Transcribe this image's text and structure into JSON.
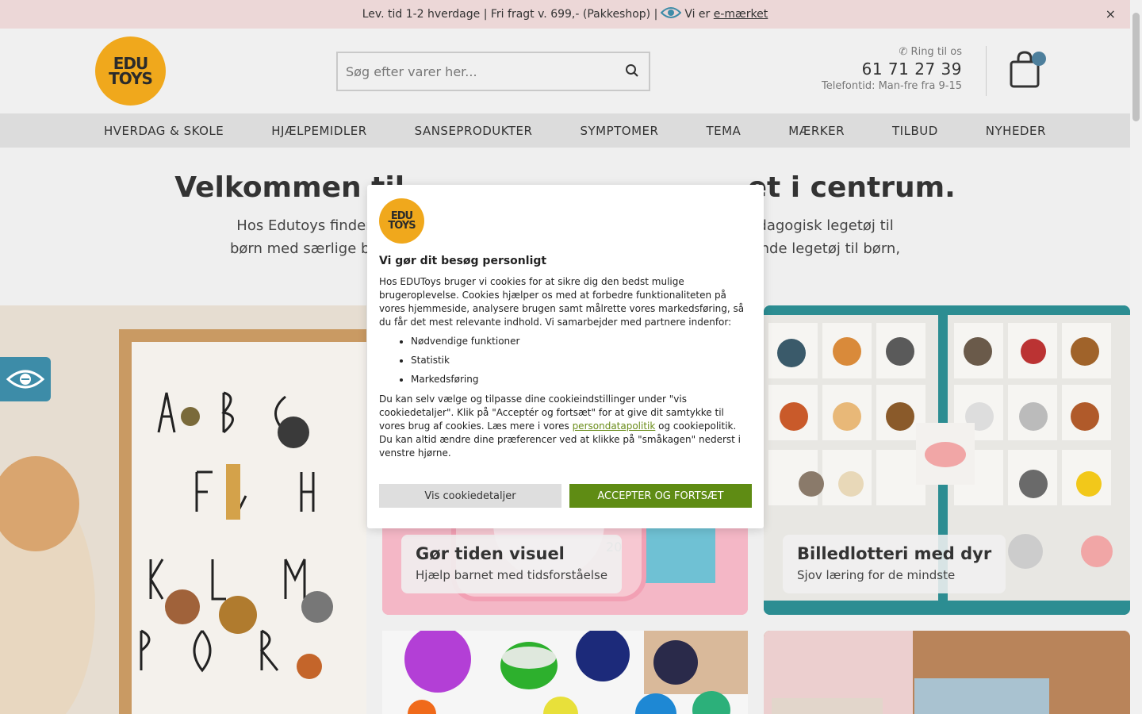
{
  "announcement": {
    "text": "Lev. tid 1-2 hverdage | Fri fragt v. 699,- (Pakkeshop) |",
    "emark_prefix": "Vi er",
    "emark_link": "e-mærket",
    "close": "×"
  },
  "header": {
    "logo_line1": "EDU",
    "logo_line2": "TOYS",
    "search_placeholder": "Søg efter varer her...",
    "phone_label": "Ring til os",
    "phone_number": "61 71 27 39",
    "phone_hours": "Telefontid: Man-fre fra 9-15"
  },
  "nav": {
    "items": [
      "HVERDAG & SKOLE",
      "HJÆLPEMIDLER",
      "SANSEPRODUKTER",
      "SYMPTOMER",
      "TEMA",
      "MÆRKER",
      "TILBUD",
      "NYHEDER"
    ]
  },
  "welcome": {
    "title_left": "Velkommen til ",
    "title_right": "et i centrum.",
    "line1_left": "Hos Edutoys finder ",
    "line1_right": "edagogisk legetøj til",
    "line2_left": "børn med særlige be",
    "line2_right": "ende legetøj til børn,"
  },
  "tiles": {
    "pink": {
      "title": "Gør tiden visuel",
      "subtitle": "Hjælp barnet med tidsforståelse"
    },
    "animals": {
      "title": "Billedlotteri med dyr",
      "subtitle": "Sjov læring for de mindste"
    }
  },
  "cookie": {
    "logo_line1": "EDU",
    "logo_line2": "TOYS",
    "title": "Vi gør dit besøg personligt",
    "intro": "Hos EDUToys bruger vi cookies for at sikre dig den bedst mulige brugeroplevelse. Cookies hjælper os med at forbedre funktionaliteten på vores hjemmeside, analysere brugen samt målrette vores markedsføring, så du får det mest relevante indhold. Vi samarbejder med partnere indenfor:",
    "items": [
      "Nødvendige funktioner",
      "Statistik",
      "Markedsføring"
    ],
    "body_before": "Du kan selv vælge og tilpasse dine cookieindstillinger under \"vis cookiedetaljer\". Klik på \"Acceptér og fortsæt\" for at give dit samtykke til vores brug af cookies. Læs mere i vores ",
    "policy_link": "persondatapolitik",
    "body_after": " og cookiepolitik. Du kan altid ændre dine præferencer ved at klikke på \"småkagen\" nederst i venstre hjørne.",
    "details_button": "Vis cookiedetaljer",
    "accept_button": "ACCEPTER OG FORTSÆT"
  },
  "colors": {
    "announcement_bg": "#ecd7d7",
    "logo_yellow": "#f0a81c",
    "accept_green": "#5f8c14",
    "link_green": "#6a8c1a",
    "accent_blue": "#3d8ca8"
  },
  "icons": [
    "eye-icon",
    "close-icon",
    "search-icon",
    "phone-icon",
    "cart-icon",
    "accessibility-icon"
  ]
}
